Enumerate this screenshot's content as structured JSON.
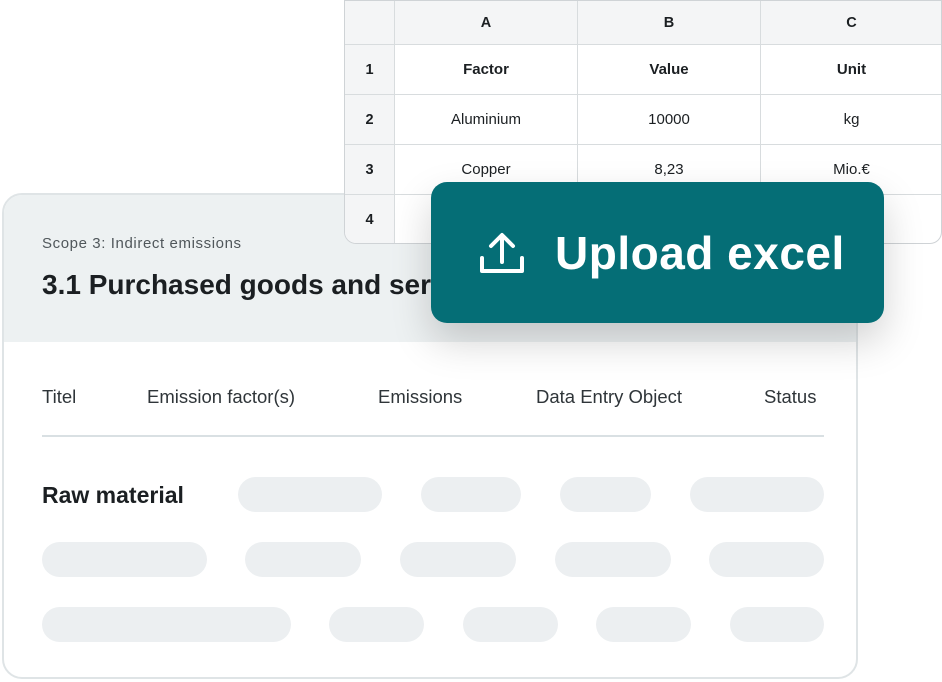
{
  "card": {
    "scope_label": "Scope 3: Indirect emissions",
    "title": "3.1 Purchased goods and services",
    "columns": [
      "Titel",
      "Emission factor(s)",
      "Emissions",
      "Data Entry Object",
      "Status"
    ],
    "row_label": "Raw material"
  },
  "spreadsheet": {
    "column_headers": [
      "A",
      "B",
      "C"
    ],
    "row_numbers": [
      "1",
      "2",
      "3",
      "4"
    ],
    "rows": [
      [
        "Factor",
        "Value",
        "Unit"
      ],
      [
        "Aluminium",
        "10000",
        "kg"
      ],
      [
        "Copper",
        "8,23",
        "Mio.€"
      ],
      [
        "",
        "",
        ""
      ]
    ]
  },
  "upload_button": {
    "label": "Upload excel",
    "icon": "upload-icon"
  },
  "colors": {
    "accent": "#056e76",
    "card_header_bg": "#edf1f2",
    "placeholder": "#eceff1"
  }
}
